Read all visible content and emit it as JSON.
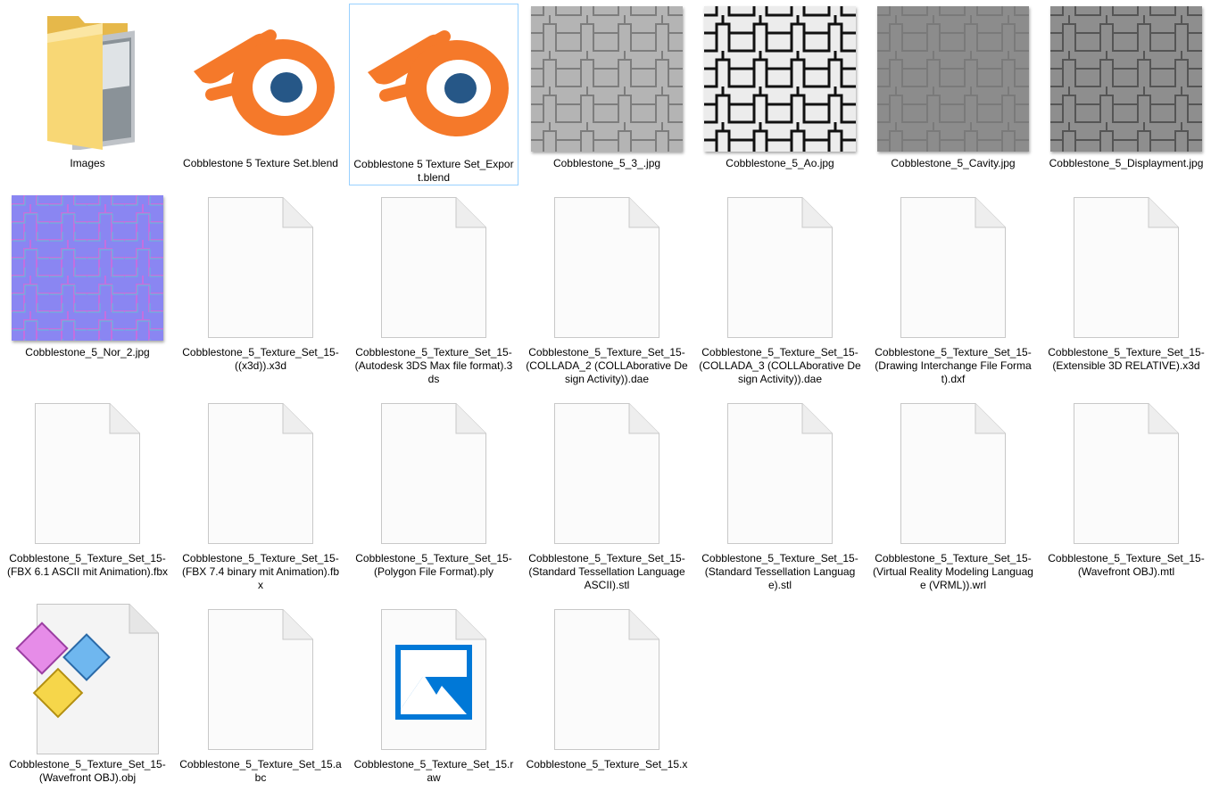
{
  "files": [
    {
      "name": "Images",
      "icon": "folder-icon",
      "type": "folder"
    },
    {
      "name": "Cobblestone 5  Texture Set.blend",
      "icon": "blender-icon",
      "type": "blend"
    },
    {
      "name": "Cobblestone 5  Texture Set_Export.blend",
      "icon": "blender-icon",
      "type": "blend",
      "selected": true
    },
    {
      "name": "Cobblestone_5_3_.jpg",
      "icon": "texture-color-thumbnail",
      "type": "image"
    },
    {
      "name": "Cobblestone_5_Ao.jpg",
      "icon": "texture-ao-thumbnail",
      "type": "image"
    },
    {
      "name": "Cobblestone_5_Cavity.jpg",
      "icon": "texture-cavity-thumbnail",
      "type": "image"
    },
    {
      "name": "Cobblestone_5_Displayment.jpg",
      "icon": "texture-displacement-thumbnail",
      "type": "image"
    },
    {
      "name": "Cobblestone_5_Nor_2.jpg",
      "icon": "texture-normal-thumbnail",
      "type": "image"
    },
    {
      "name": "Cobblestone_5_Texture_Set_15-((x3d)).x3d",
      "icon": "blank-document-icon",
      "type": "file"
    },
    {
      "name": "Cobblestone_5_Texture_Set_15-(Autodesk 3DS Max file format).3ds",
      "icon": "blank-document-icon",
      "type": "file"
    },
    {
      "name": "Cobblestone_5_Texture_Set_15-(COLLADA_2 (COLLAborative Design Activity)).dae",
      "icon": "blank-document-icon",
      "type": "file"
    },
    {
      "name": "Cobblestone_5_Texture_Set_15-(COLLADA_3 (COLLAborative Design Activity)).dae",
      "icon": "blank-document-icon",
      "type": "file"
    },
    {
      "name": "Cobblestone_5_Texture_Set_15-(Drawing Interchange File Format).dxf",
      "icon": "blank-document-icon",
      "type": "file"
    },
    {
      "name": "Cobblestone_5_Texture_Set_15-(Extensible 3D RELATIVE).x3d",
      "icon": "blank-document-icon",
      "type": "file"
    },
    {
      "name": "Cobblestone_5_Texture_Set_15-(FBX 6.1 ASCII mit Animation).fbx",
      "icon": "blank-document-icon",
      "type": "file"
    },
    {
      "name": "Cobblestone_5_Texture_Set_15-(FBX 7.4 binary mit Animation).fbx",
      "icon": "blank-document-icon",
      "type": "file"
    },
    {
      "name": "Cobblestone_5_Texture_Set_15-(Polygon File Format).ply",
      "icon": "blank-document-icon",
      "type": "file"
    },
    {
      "name": "Cobblestone_5_Texture_Set_15-(Standard Tessellation Language ASCII).stl",
      "icon": "blank-document-icon",
      "type": "file"
    },
    {
      "name": "Cobblestone_5_Texture_Set_15-(Standard Tessellation Language).stl",
      "icon": "blank-document-icon",
      "type": "file"
    },
    {
      "name": "Cobblestone_5_Texture_Set_15-(Virtual Reality Modeling Language (VRML)).wrl",
      "icon": "blank-document-icon",
      "type": "file"
    },
    {
      "name": "Cobblestone_5_Texture_Set_15-(Wavefront OBJ).mtl",
      "icon": "blank-document-icon",
      "type": "file"
    },
    {
      "name": "Cobblestone_5_Texture_Set_15-(Wavefront OBJ).obj",
      "icon": "3d-object-document-icon",
      "type": "obj"
    },
    {
      "name": "Cobblestone_5_Texture_Set_15.abc",
      "icon": "blank-document-icon",
      "type": "file"
    },
    {
      "name": "Cobblestone_5_Texture_Set_15.raw",
      "icon": "image-document-icon",
      "type": "raw"
    },
    {
      "name": "Cobblestone_5_Texture_Set_15.x",
      "icon": "blank-document-icon",
      "type": "file"
    }
  ],
  "colors": {
    "selection_border": "#99d1ff",
    "blender_orange": "#f5792a",
    "blender_blue": "#265787",
    "folder_yellow": "#f8d775",
    "normal_map_blue": "#8080ff",
    "photo_icon_blue": "#0078d7"
  }
}
